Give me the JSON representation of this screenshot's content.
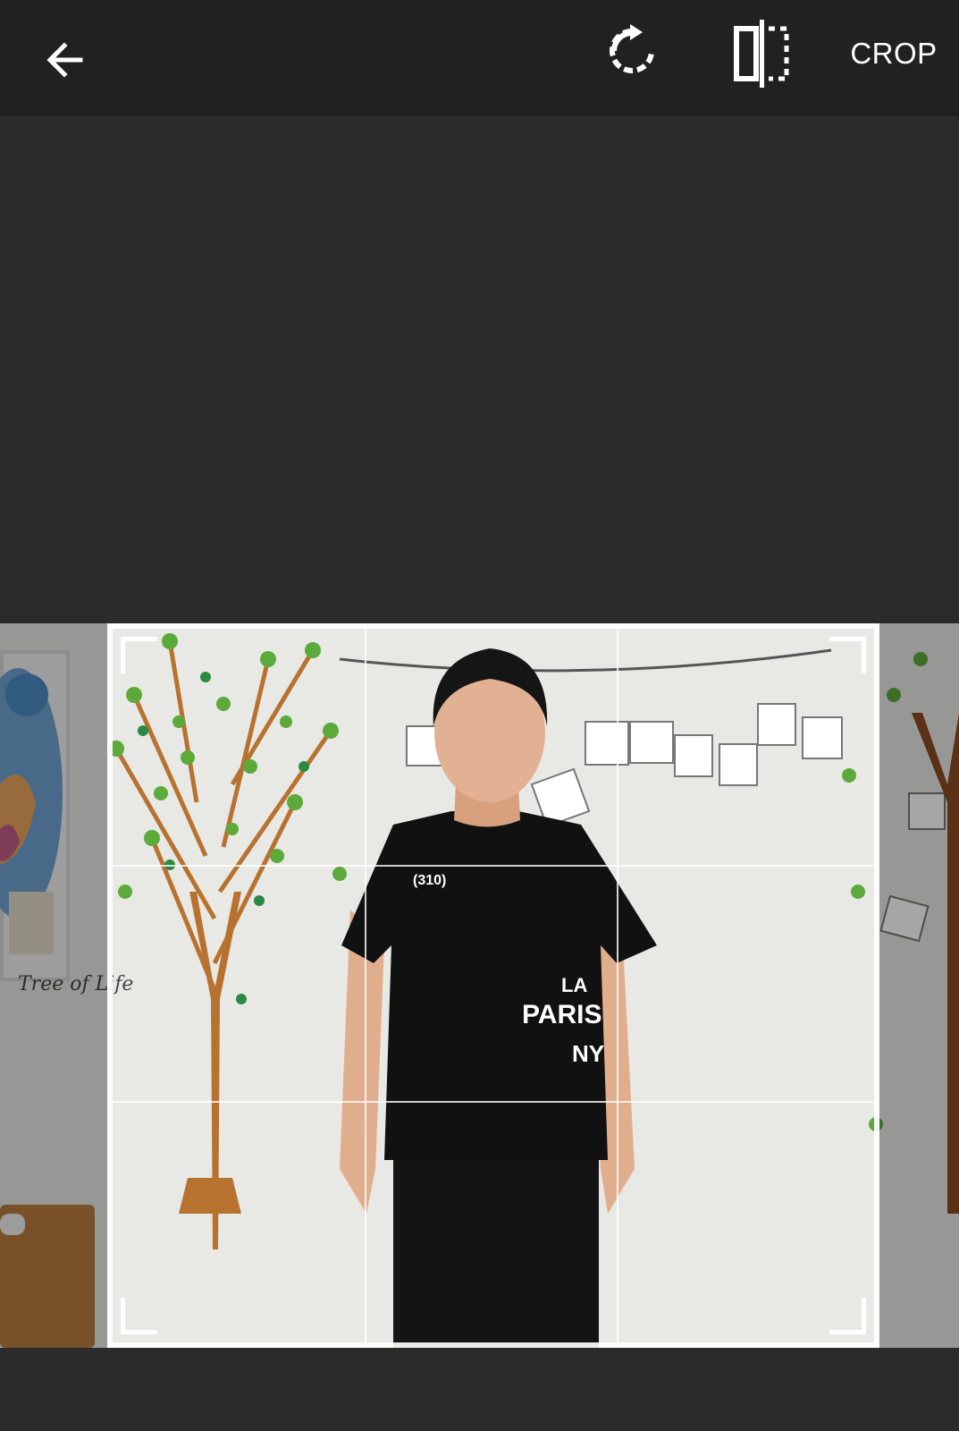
{
  "toolbar": {
    "back_icon": "arrow-left-icon",
    "rotate_icon": "rotate-icon",
    "flip_icon": "flip-horizontal-icon",
    "crop_label": "CROP"
  },
  "photo": {
    "shirt_text": {
      "number": "(310)",
      "line1": "LA",
      "line2": "PARIS",
      "line3": "NY"
    },
    "wall_text": "Tree of Life"
  },
  "colors": {
    "toolbar_bg": "#212121",
    "canvas_bg": "#2b2b2b",
    "frame": "#ffffff"
  }
}
